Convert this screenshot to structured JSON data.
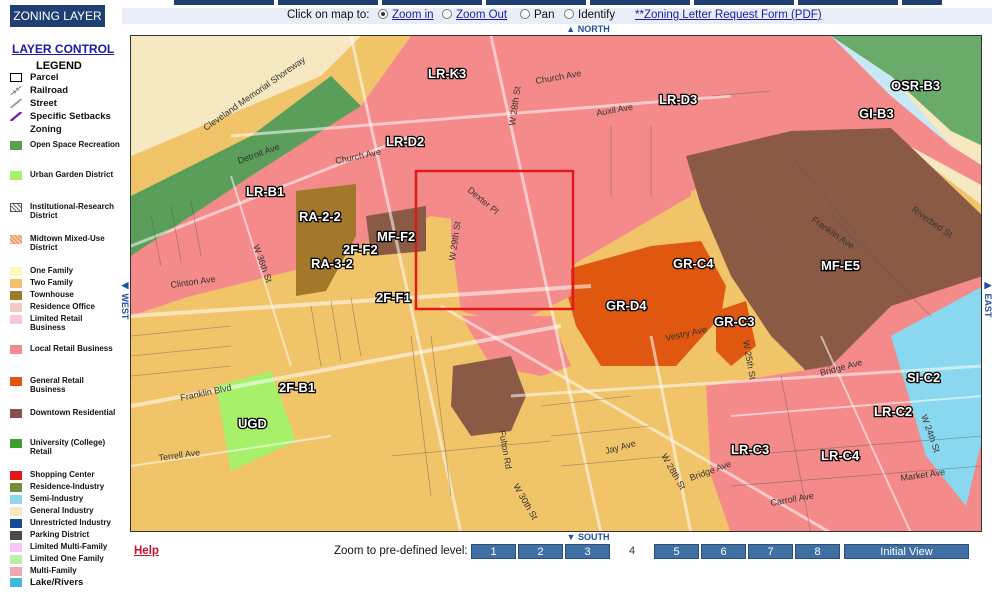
{
  "left_panel": {
    "tab_label": "ZONING LAYER",
    "layer_control": "LAYER CONTROL",
    "legend_title": "LEGEND",
    "base_layers": [
      {
        "label": "Parcel",
        "icon": "parcel-icon"
      },
      {
        "label": "Railroad",
        "icon": "railroad-icon"
      },
      {
        "label": "Street",
        "icon": "street-icon"
      },
      {
        "label": "Specific Setbacks",
        "icon": "setback-icon"
      },
      {
        "label": "Zoning",
        "icon": "none"
      }
    ],
    "zoning_classes": [
      {
        "label": "Open Space Recreation",
        "color": "#5a9e5a"
      },
      {
        "label": "Urban Garden District",
        "color": "#a6f06a"
      },
      {
        "label": "Institutional-Research District",
        "color": "#c9c9e0"
      },
      {
        "label": "Midtown Mixed-Use District",
        "color": "#f4b08a"
      },
      {
        "label": "One Family",
        "color": "#fff7c0"
      },
      {
        "label": "Two Family",
        "color": "#f2c46a"
      },
      {
        "label": "Townhouse",
        "color": "#a4782a"
      },
      {
        "label": "Residence Office",
        "color": "#f6c9c9"
      },
      {
        "label": "Limited Retail Business",
        "color": "#f8c8d8"
      },
      {
        "label": "Local Retail Business",
        "color": "#f48a8a"
      },
      {
        "label": "General Retail Business",
        "color": "#e0580f"
      },
      {
        "label": "Downtown Residential",
        "color": "#8a5050"
      },
      {
        "label": "University (College) Retail",
        "color": "#3aa02a"
      },
      {
        "label": "Shopping Center",
        "color": "#e01a1a"
      },
      {
        "label": "Residence-Industry",
        "color": "#7a8a3a"
      },
      {
        "label": "Semi-Industry",
        "color": "#8ad8f0"
      },
      {
        "label": "General Industry",
        "color": "#f6e8c0"
      },
      {
        "label": "Unrestricted Industry",
        "color": "#1a4a9a"
      },
      {
        "label": "Parking District",
        "color": "#4a4a4a"
      },
      {
        "label": "Limited Multi-Family",
        "color": "#f8c8f0"
      },
      {
        "label": "Limited One Family",
        "color": "#b8f0a8"
      },
      {
        "label": "Multi-Family",
        "color": "#f0a8b0"
      },
      {
        "label": "Lake/Rivers",
        "color": "#3ab8e0"
      }
    ]
  },
  "toolbar": {
    "prompt": "Click on map to:",
    "zoom_in": "Zoom in",
    "zoom_out": "Zoom Out",
    "pan": "Pan",
    "identify": "Identify",
    "request_form": "**Zoning Letter Request Form (PDF)"
  },
  "nav": {
    "north": "NORTH",
    "south": "SOUTH",
    "west": "WEST",
    "east": "EAST"
  },
  "map": {
    "zone_labels": [
      "LR-K3",
      "LR-D3",
      "OSR-B3",
      "GI-B3",
      "LR-D2",
      "LR-B1",
      "RA-2-2",
      "MF-F2",
      "2F-F2",
      "RA-3-2",
      "2F-F1",
      "GR-C4",
      "MF-E5",
      "GR-D4",
      "GR-C3",
      "2F-B1",
      "UGD",
      "SI-C2",
      "LR-C2",
      "LR-C3",
      "LR-C4"
    ],
    "street_labels": [
      "Church Ave",
      "Cleveland Memorial Shoreway",
      "Detroit Ave",
      "Church Ave",
      "W 28th St",
      "Auxil Ave",
      "Riverbed St",
      "Dexter Pl",
      "W 29th St",
      "Franklin Ave",
      "Clinton Ave",
      "W 36th St",
      "Vestry Ave",
      "W 25th St",
      "Franklin Blvd",
      "Terrell Ave",
      "W 24th St",
      "Bridge Ave",
      "Fulton Rd",
      "Jay Ave",
      "W 28th St",
      "W 30th St",
      "Bridge Ave",
      "Market Ave",
      "Carroll Ave"
    ]
  },
  "bottom_bar": {
    "help": "Help",
    "zoom_prompt": "Zoom to pre-defined level:",
    "levels": [
      "1",
      "2",
      "3",
      "4",
      "5",
      "6",
      "7",
      "8"
    ],
    "current_level": "4",
    "initial_view": "Initial View"
  }
}
